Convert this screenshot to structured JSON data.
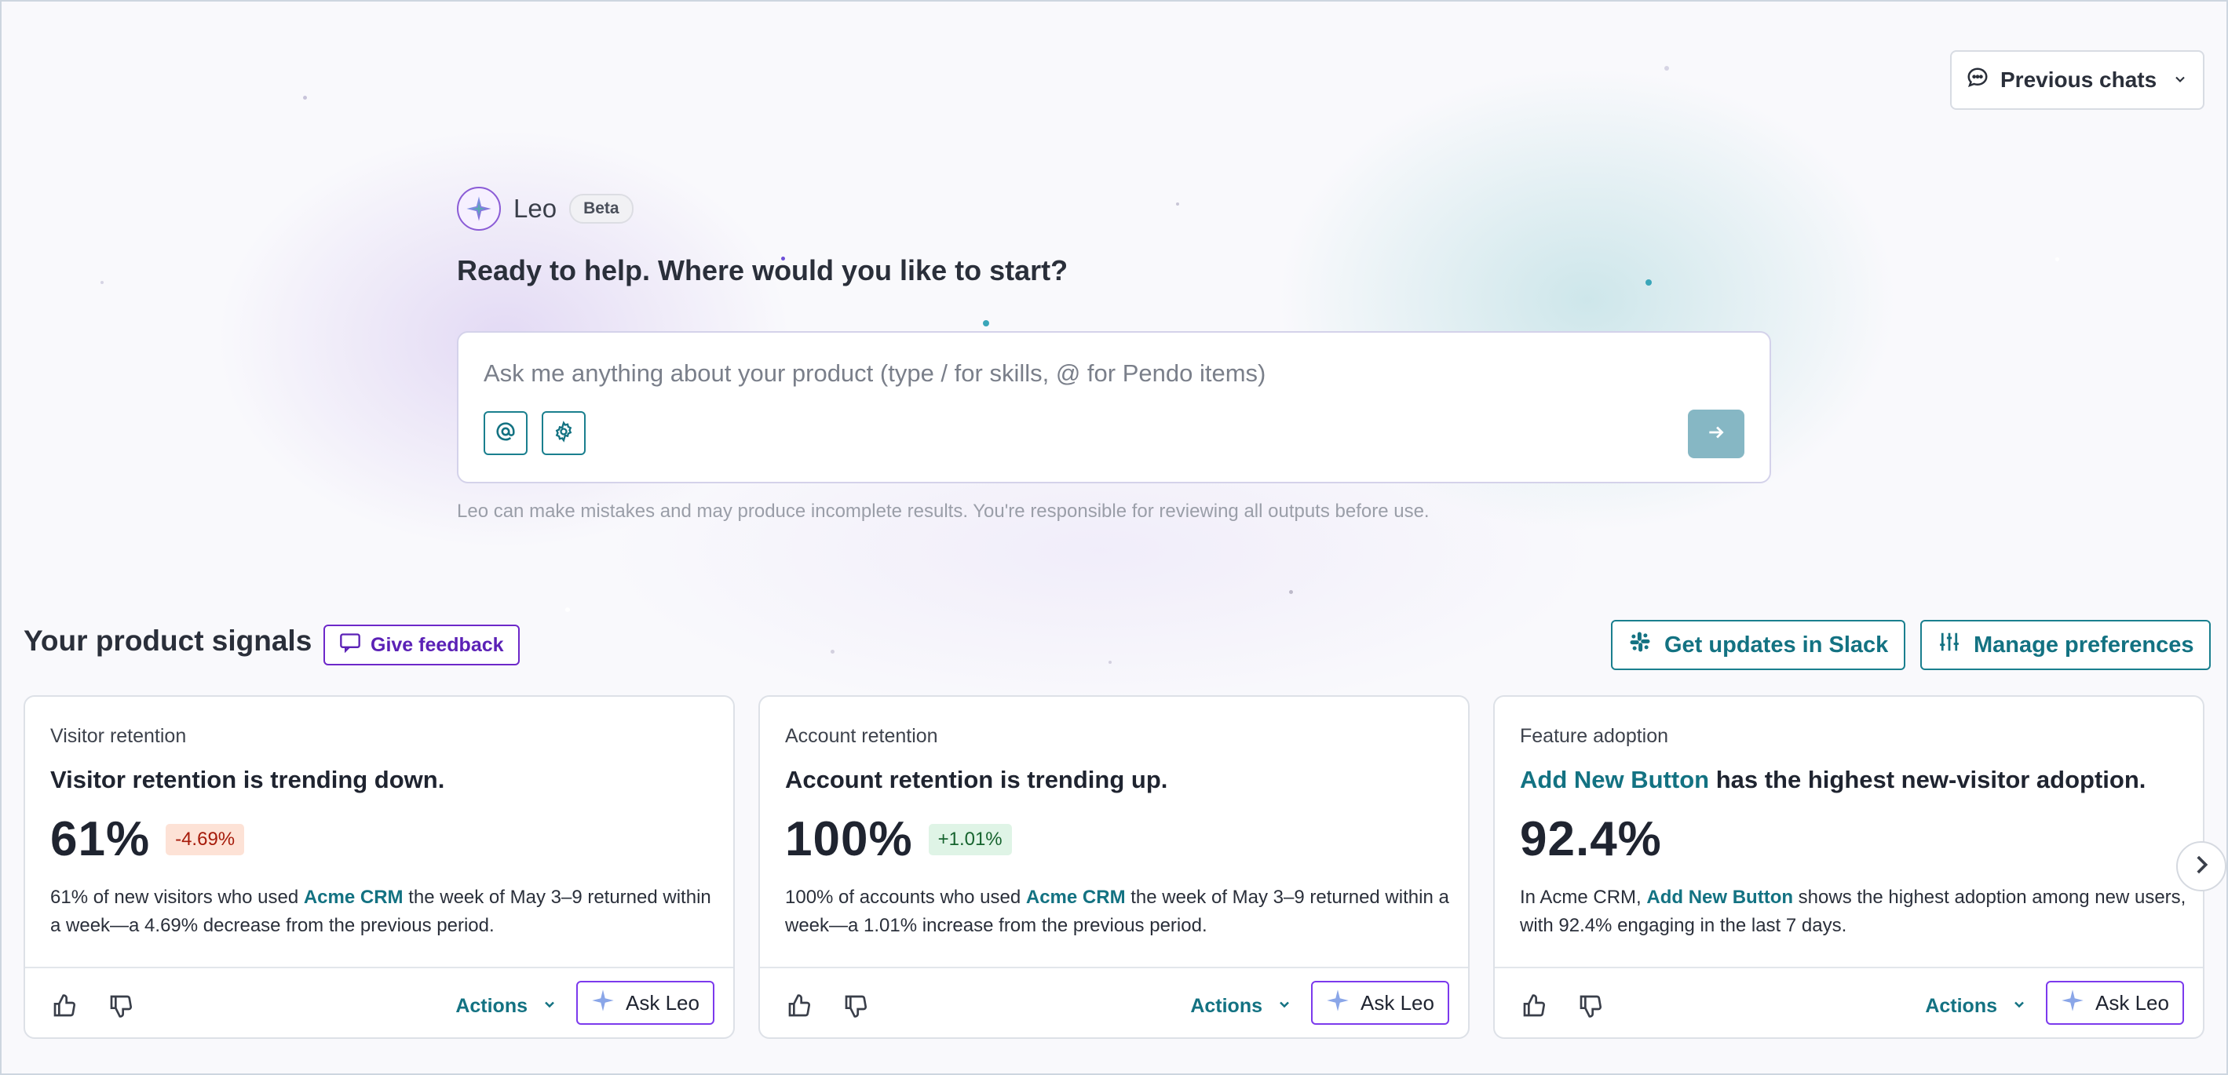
{
  "header": {
    "previous_chats_label": "Previous chats"
  },
  "hero": {
    "assistant_name": "Leo",
    "badge": "Beta",
    "title": "Ready to help. Where would you like to start?",
    "input_placeholder": "Ask me anything about your product (type / for skills, @ for Pendo items)",
    "input_value": "",
    "disclaimer": "Leo can make mistakes and may produce incomplete results. You're responsible for reviewing all outputs before use."
  },
  "signals": {
    "title": "Your product signals",
    "feedback_label": "Give feedback",
    "slack_label": "Get updates in Slack",
    "preferences_label": "Manage preferences",
    "cards": [
      {
        "category": "Visitor retention",
        "headline": "Visitor retention is trending down.",
        "metric": "61%",
        "delta": "-4.69%",
        "delta_direction": "down",
        "desc_pre": "61% of new visitors who used ",
        "desc_link": "Acme CRM",
        "desc_post": " the week of May 3–9 returned within a week—a 4.69% decrease from the previous period.",
        "actions_label": "Actions",
        "ask_label": "Ask Leo"
      },
      {
        "category": "Account retention",
        "headline": "Account retention is trending up.",
        "metric": "100%",
        "delta": "+1.01%",
        "delta_direction": "up",
        "desc_pre": "100% of accounts who used ",
        "desc_link": "Acme CRM",
        "desc_post": " the week of May 3–9 returned within a week—a 1.01% increase from the previous period.",
        "actions_label": "Actions",
        "ask_label": "Ask Leo"
      },
      {
        "category": "Feature adoption",
        "headline_link": "Add New Button",
        "headline_post": " has the highest new-visitor adoption.",
        "metric": "92.4%",
        "desc_pre": "In Acme CRM, ",
        "desc_link": "Add New Button",
        "desc_post": " shows the highest adoption among new users, with 92.4% engaging in the last 7 days.",
        "actions_label": "Actions",
        "ask_label": "Ask Leo"
      }
    ]
  },
  "colors": {
    "accent_teal": "#137282",
    "accent_purple": "#6d28c9",
    "delta_down_bg": "#fde2d6",
    "delta_up_bg": "#dff4e6"
  },
  "icons": [
    "chat-bubble-icon",
    "chevron-down-icon",
    "leo-sparkle-logo",
    "at-sign-icon",
    "gear-icon",
    "arrow-right-icon",
    "feedback-icon",
    "slack-icon",
    "sliders-icon",
    "thumbs-up-icon",
    "thumbs-down-icon",
    "chevron-right-icon"
  ]
}
